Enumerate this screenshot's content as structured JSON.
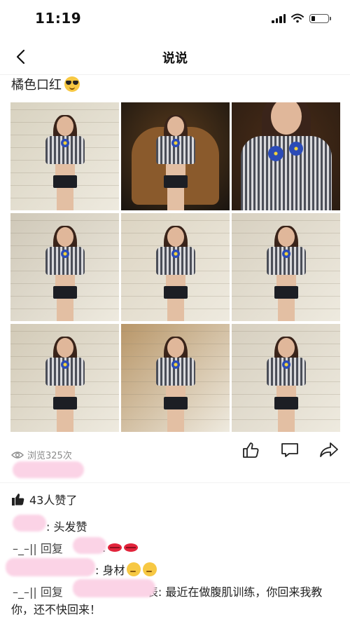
{
  "status_bar": {
    "time": "11:19"
  },
  "nav": {
    "title": "说说"
  },
  "post": {
    "text": "橘色口红",
    "emoji": "smiling-face-with-sunglasses",
    "views": "浏览325次",
    "likes": "43人赞了"
  },
  "photos": [
    {
      "bg": "#d8d2c0"
    },
    {
      "bg": "#1a1510"
    },
    {
      "bg": "#2a1c12"
    },
    {
      "bg": "#cfc8b8"
    },
    {
      "bg": "#dcd4c2"
    },
    {
      "bg": "#d7d0c0"
    },
    {
      "bg": "#d2cab7"
    },
    {
      "bg": "#b89668"
    },
    {
      "bg": "#d6cfbf"
    }
  ],
  "comments": [
    {
      "prefix": "",
      "suffix": ": 头发赞",
      "emojis": []
    },
    {
      "prefix": "–_–|| 回复",
      "suffix": ":",
      "emojis": [
        "lips",
        "lips"
      ]
    },
    {
      "prefix": "",
      "suffix": ": 身材",
      "emojis": [
        "thinking",
        "thinking"
      ]
    },
    {
      "prefix": "–_–|| 回复",
      "suffix": "表: 最近在做腹肌训练，你回来我教",
      "emojis": []
    },
    {
      "prefix": "你，还不快回来！",
      "suffix": "",
      "emojis": []
    }
  ],
  "colors": {
    "accent_blur": "#fbd3e6",
    "muted_text": "#8a8a8a"
  }
}
